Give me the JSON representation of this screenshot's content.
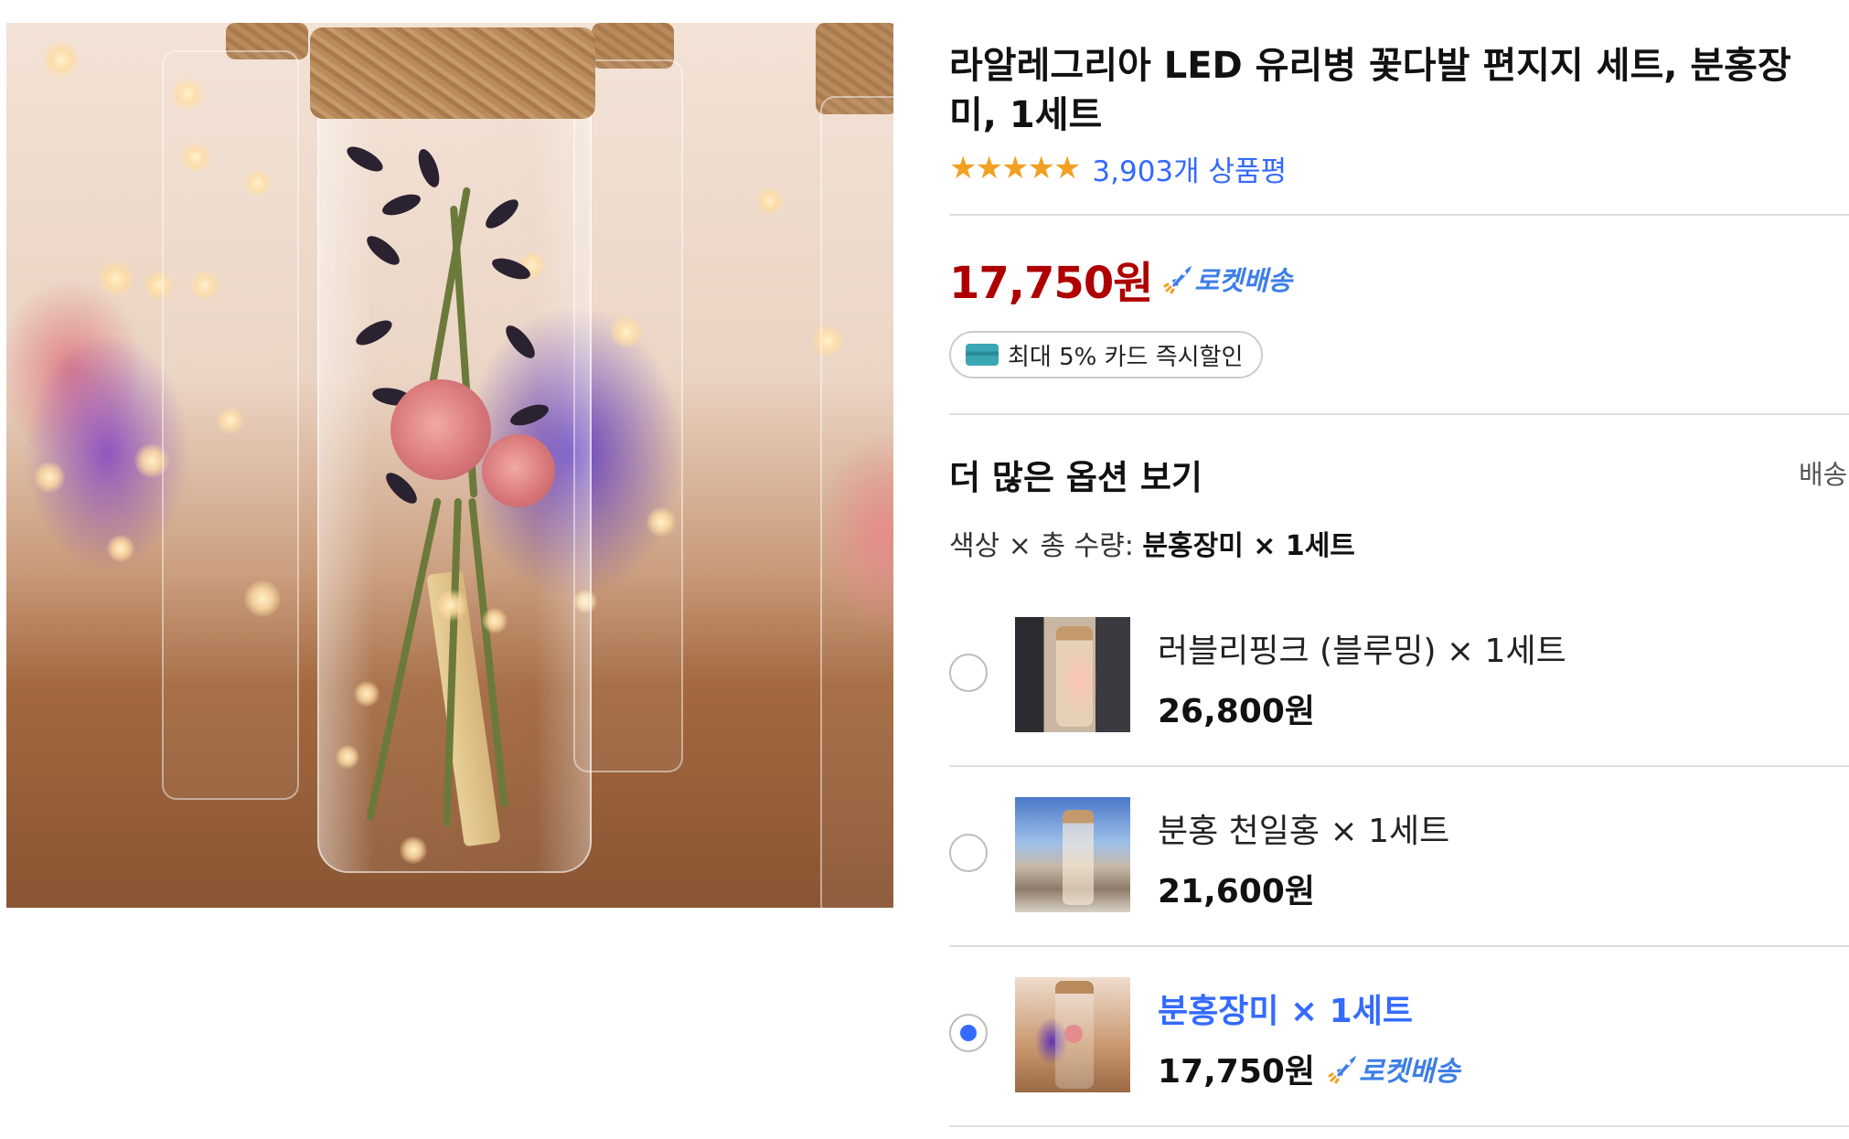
{
  "product": {
    "title": "라알레그리아 LED 유리병 꽃다발 편지지 세트, 분홍장미, 1세트",
    "rating_stars": 5,
    "review_count_text": "3,903개 상품평",
    "price": "17,750원",
    "delivery_badge": "로켓배송",
    "card_discount": "최대 5% 카드 즉시할인"
  },
  "options": {
    "heading": "더 많은 옵션 보기",
    "shipping_label": "배송",
    "selection_prefix": "색상 × 총 수량: ",
    "selection_value": "분홍장미 × 1세트",
    "items": [
      {
        "name": "러블리핑크 (블루밍) × 1세트",
        "price": "26,800원",
        "selected": false,
        "rocket": ""
      },
      {
        "name": "분홍 천일홍 × 1세트",
        "price": "21,600원",
        "selected": false,
        "rocket": ""
      },
      {
        "name": "분홍장미 × 1세트",
        "price": "17,750원",
        "selected": true,
        "rocket": "로켓배송"
      }
    ]
  },
  "colors": {
    "price_red": "#ae0000",
    "link_blue": "#346aff",
    "rocket_blue": "#3d7ee8",
    "star_orange": "#f2a022"
  },
  "icons": [
    "rocket-icon",
    "star-icon",
    "card-icon",
    "radio-icon"
  ]
}
